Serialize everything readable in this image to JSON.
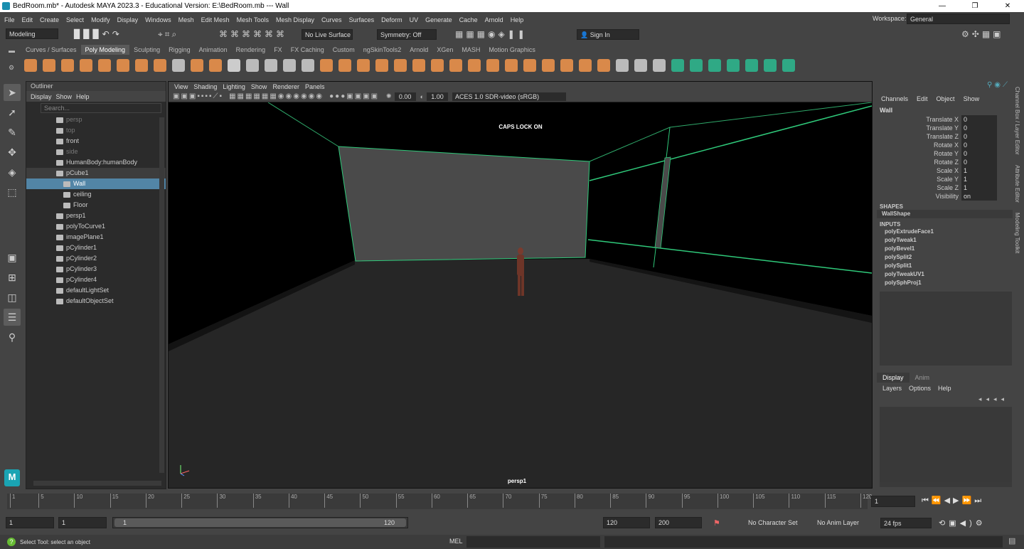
{
  "title": "BedRoom.mb* - Autodesk MAYA 2023.3 - Educational Version: E:\\BedRoom.mb  ---  Wall",
  "menu": [
    "File",
    "Edit",
    "Create",
    "Select",
    "Modify",
    "Display",
    "Windows",
    "Mesh",
    "Edit Mesh",
    "Mesh Tools",
    "Mesh Display",
    "Curves",
    "Surfaces",
    "Deform",
    "UV",
    "Generate",
    "Cache",
    "Arnold",
    "Help"
  ],
  "workspace": {
    "label": "Workspace:",
    "value": "General"
  },
  "status_line": {
    "mode": "Modeling",
    "live_surface": "No Live Surface",
    "symmetry": "Symmetry: Off",
    "sign_in": "Sign In"
  },
  "shelf_tabs": [
    "Curves / Surfaces",
    "Poly Modeling",
    "Sculpting",
    "Rigging",
    "Animation",
    "Rendering",
    "FX",
    "FX Caching",
    "Custom",
    "ngSkinTools2",
    "Arnold",
    "XGen",
    "MASH",
    "Motion Graphics"
  ],
  "shelf_active": "Poly Modeling",
  "outliner": {
    "title": "Outliner",
    "menu": [
      "Display",
      "Show",
      "Help"
    ],
    "search_placeholder": "Search...",
    "items": [
      "persp",
      "top",
      "front",
      "side",
      "HumanBody:humanBody",
      "pCube1",
      "Wall",
      "ceiling",
      "Floor",
      "persp1",
      "polyToCurve1",
      "imagePlane1",
      "pCylinder1",
      "pCylinder2",
      "pCylinder3",
      "pCylinder4",
      "defaultLightSet",
      "defaultObjectSet"
    ]
  },
  "viewport": {
    "menu": [
      "View",
      "Shading",
      "Lighting",
      "Show",
      "Renderer",
      "Panels"
    ],
    "exposure": "0.00",
    "gamma": "1.00",
    "color_space": "ACES 1.0 SDR-video (sRGB)",
    "caps_lock": "CAPS LOCK ON",
    "camera": "persp1"
  },
  "channel_box": {
    "menu": [
      "Channels",
      "Edit",
      "Object",
      "Show"
    ],
    "object": "Wall",
    "attributes": [
      {
        "name": "Translate X",
        "value": "0"
      },
      {
        "name": "Translate Y",
        "value": "0"
      },
      {
        "name": "Translate Z",
        "value": "0"
      },
      {
        "name": "Rotate X",
        "value": "0"
      },
      {
        "name": "Rotate Y",
        "value": "0"
      },
      {
        "name": "Rotate Z",
        "value": "0"
      },
      {
        "name": "Scale X",
        "value": "1"
      },
      {
        "name": "Scale Y",
        "value": "1"
      },
      {
        "name": "Scale Z",
        "value": "1"
      },
      {
        "name": "Visibility",
        "value": "on"
      }
    ],
    "shapes_label": "SHAPES",
    "shape": "WallShape",
    "inputs_label": "INPUTS",
    "inputs": [
      "polyExtrudeFace1",
      "polyTweak1",
      "polyBevel1",
      "polySplit2",
      "polySplit1",
      "polyTweakUV1",
      "polySphProj1"
    ]
  },
  "layer_editor": {
    "tabs": [
      "Display",
      "Anim"
    ],
    "menu": [
      "Layers",
      "Options",
      "Help"
    ]
  },
  "side_tabs": [
    "Channel Box / Layer Editor",
    "Attribute Editor",
    "Modeling Toolkit"
  ],
  "time_slider": {
    "ticks": [
      "1",
      "5",
      "10",
      "15",
      "20",
      "25",
      "30",
      "35",
      "40",
      "45",
      "50",
      "55",
      "60",
      "65",
      "70",
      "75",
      "80",
      "85",
      "90",
      "95",
      "100",
      "105",
      "110",
      "115",
      "120"
    ],
    "current_frame": "1"
  },
  "range": {
    "start": "1",
    "start2": "1",
    "range_start": "1",
    "range_end": "120",
    "end": "120",
    "end2": "200",
    "character_set": "No Character Set",
    "anim_layer": "No Anim Layer",
    "fps": "24 fps"
  },
  "help_line": {
    "text": "Select Tool: select an object",
    "mel": "MEL"
  }
}
